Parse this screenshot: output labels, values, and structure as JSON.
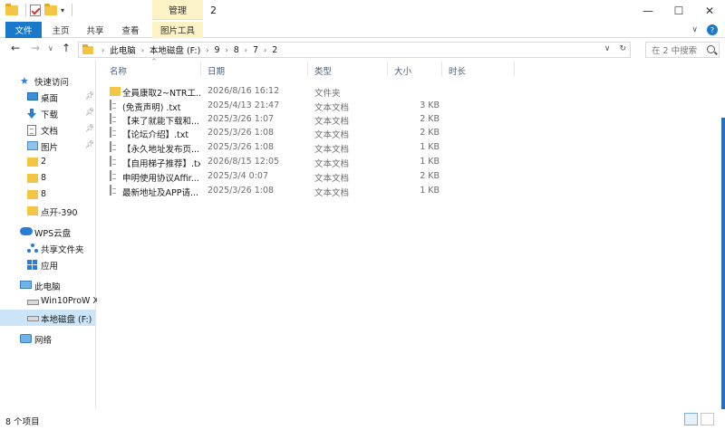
{
  "window": {
    "title": "2",
    "manage_label": "管理",
    "controls": [
      "—",
      "☐",
      "✕"
    ]
  },
  "ribbon": {
    "tabs": [
      "文件",
      "主页",
      "共享",
      "查看",
      "图片工具"
    ]
  },
  "address": {
    "crumbs": [
      "此电脑",
      "本地磁盘 (F:)",
      "9",
      "8",
      "7",
      "2"
    ],
    "search_placeholder": "在 2 中搜索"
  },
  "sidebar": {
    "quick_access": "快速访问",
    "quick_items": [
      {
        "label": "桌面",
        "icon": "desktop-icon",
        "pinned": true
      },
      {
        "label": "下载",
        "icon": "download-icon",
        "pinned": true
      },
      {
        "label": "文档",
        "icon": "documents-icon",
        "pinned": true
      },
      {
        "label": "图片",
        "icon": "pictures-icon",
        "pinned": true
      },
      {
        "label": "2",
        "icon": "folder-icon",
        "pinned": false
      },
      {
        "label": "8",
        "icon": "folder-icon",
        "pinned": false
      },
      {
        "label": "8",
        "icon": "folder-icon",
        "pinned": false
      },
      {
        "label": "点开-390",
        "icon": "folder-icon",
        "pinned": false
      }
    ],
    "wps": "WPS云盘",
    "wps_items": [
      "共享文件夹",
      "应用"
    ],
    "this_pc": "此电脑",
    "pc_items": [
      "Win10ProW X",
      "本地磁盘 (F:)"
    ],
    "network": "网络"
  },
  "list": {
    "columns": {
      "name": "名称",
      "date": "日期",
      "type": "类型",
      "size": "大小",
      "duration": "时长"
    },
    "rows": [
      {
        "name": "全員康取2~NTR工...",
        "date": "2026/8/16 16:12",
        "type": "文件夹",
        "size": "",
        "kind": "folder"
      },
      {
        "name": "(免责声明) .txt",
        "date": "2025/4/13 21:47",
        "type": "文本文档",
        "size": "3 KB",
        "kind": "file"
      },
      {
        "name": "【来了就能下载和...",
        "date": "2025/3/26 1:07",
        "type": "文本文档",
        "size": "2 KB",
        "kind": "file"
      },
      {
        "name": "【论坛介绍】.txt",
        "date": "2025/3/26 1:08",
        "type": "文本文档",
        "size": "2 KB",
        "kind": "file"
      },
      {
        "name": "【永久地址发布页...",
        "date": "2025/3/26 1:08",
        "type": "文本文档",
        "size": "1 KB",
        "kind": "file"
      },
      {
        "name": "【自用梯子推荐】.txt",
        "date": "2026/8/15 12:05",
        "type": "文本文档",
        "size": "1 KB",
        "kind": "file"
      },
      {
        "name": "申明使用协议Affir...",
        "date": "2025/3/4 0:07",
        "type": "文本文档",
        "size": "2 KB",
        "kind": "file"
      },
      {
        "name": "最新地址及APP请...",
        "date": "2025/3/26 1:08",
        "type": "文本文档",
        "size": "1 KB",
        "kind": "file"
      }
    ]
  },
  "status": {
    "count": "8 个项目"
  }
}
